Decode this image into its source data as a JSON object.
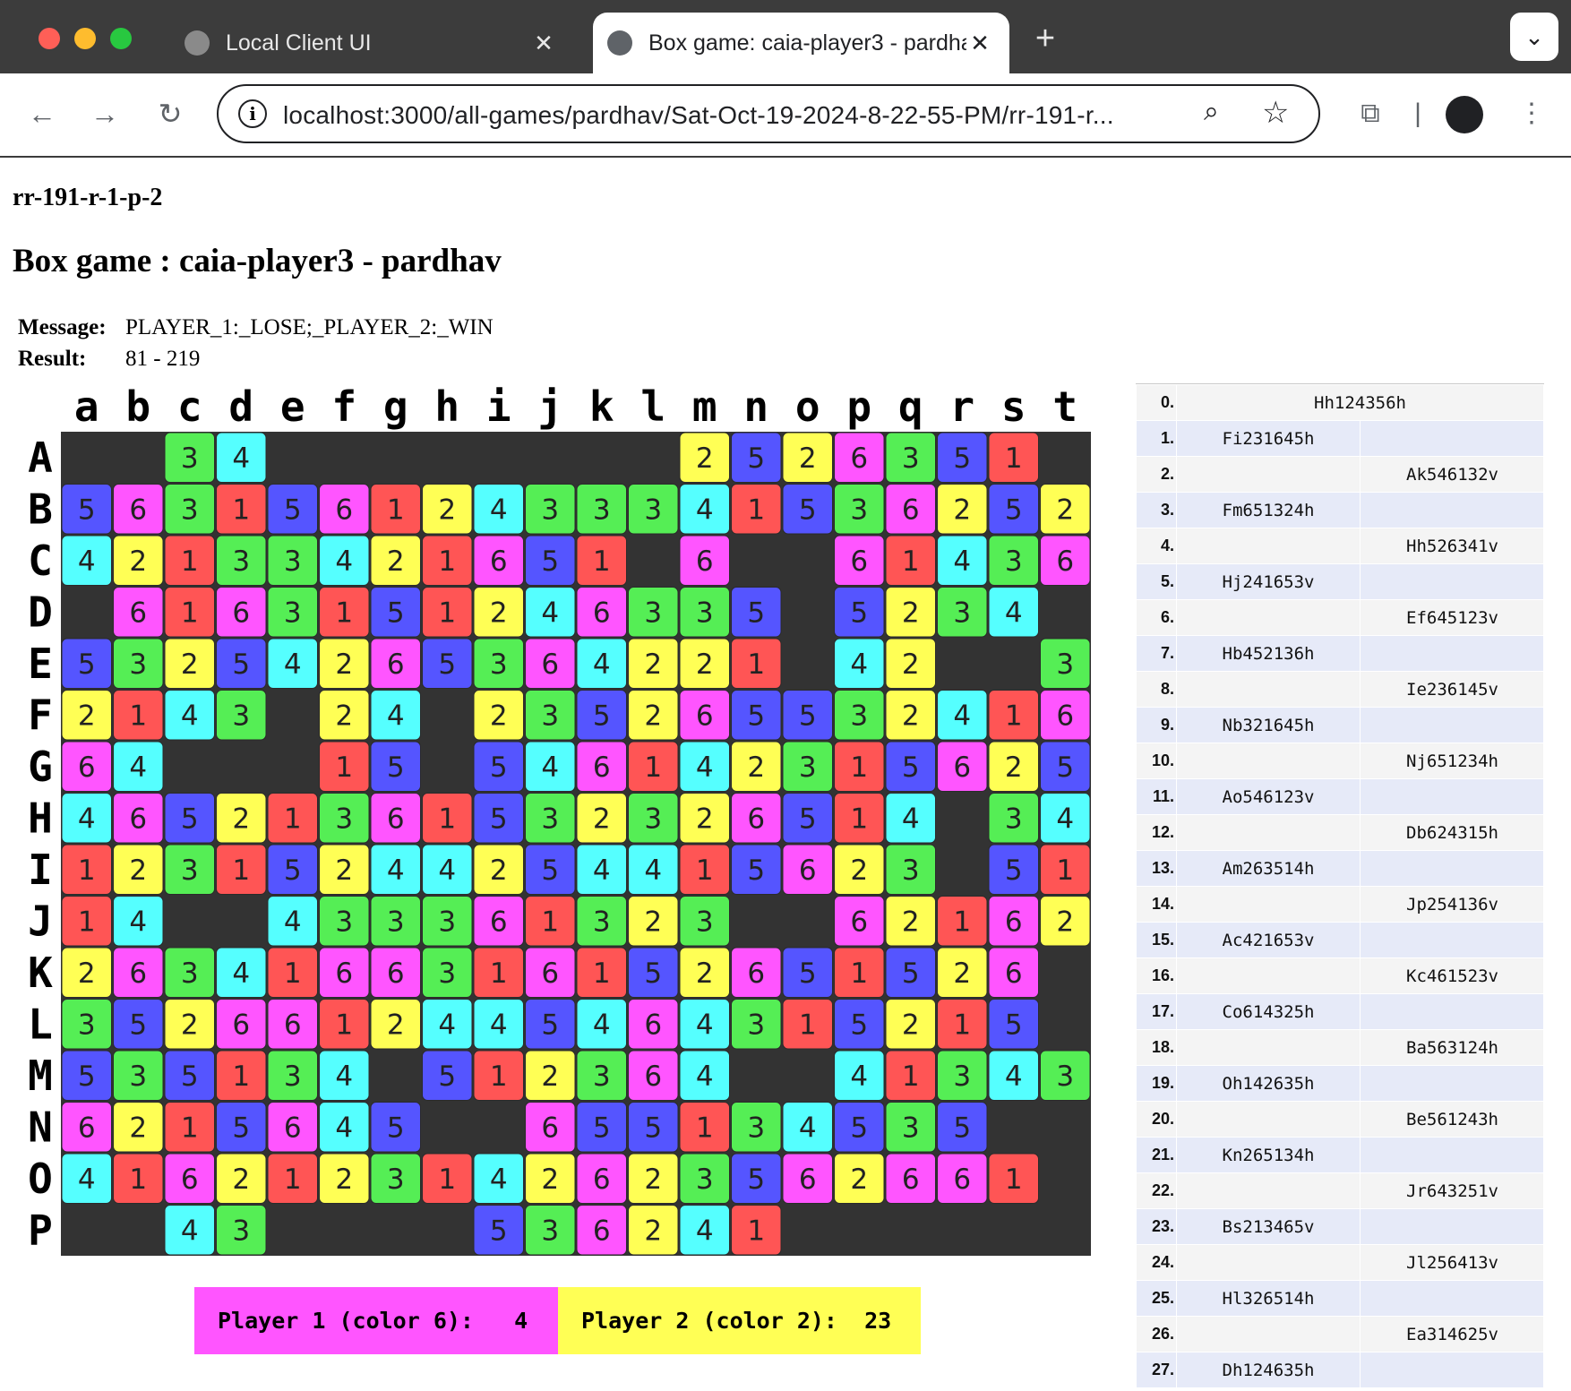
{
  "browser": {
    "tabs": [
      {
        "title": "Local Client UI"
      },
      {
        "title": "Box game: caia-player3 - pardhav"
      }
    ],
    "url": "localhost:3000/all-games/pardhav/Sat-Oct-19-2024-8-22-55-PM/rr-191-r..."
  },
  "page": {
    "game_id": "rr-191-r-1-p-2",
    "heading": "Box game : caia-player3 - pardhav",
    "message_label": "Message:",
    "message": "PLAYER_1:_LOSE;_PLAYER_2:_WIN",
    "result_label": "Result:",
    "result": "81 - 219"
  },
  "board": {
    "columns": [
      "a",
      "b",
      "c",
      "d",
      "e",
      "f",
      "g",
      "h",
      "i",
      "j",
      "k",
      "l",
      "m",
      "n",
      "o",
      "p",
      "q",
      "r",
      "s",
      "t"
    ],
    "rows": [
      "A",
      "B",
      "C",
      "D",
      "E",
      "F",
      "G",
      "H",
      "I",
      "J",
      "K",
      "L",
      "M",
      "N",
      "O",
      "P"
    ],
    "colors": {
      "1": "#ff5555",
      "2": "#ffff55",
      "3": "#55ee55",
      "4": "#55ffff",
      "5": "#5555ff",
      "6": "#ff55ff"
    },
    "grid": [
      "..34........2526351..",
      "56315612433341536252",
      "42133421651.6..61436.",
      ".6163151246335.5234.43",
      "53254265364221.42..34",
      "2143.24.235265532416",
      "64...15.54614231562 5",
      "46521361532326514.34",
      "12315244254415623.51",
      "14..433361323..621 62",
      "26341663161526515 26",
      "35266124454643152 15",
      "53513 4.51236 4..41343",
      "621564 5..655134535.",
      "416212314262356 2661.",
      "..43....536241......"
    ],
    "legend": {
      "p1_label": "Player 1 (color 6):",
      "p1_score": "4",
      "p2_label": "Player 2 (color 2):",
      "p2_score": "23"
    }
  },
  "moves": [
    {
      "n": "0.",
      "full": "Hh124356h"
    },
    {
      "n": "1.",
      "p1": "Fi231645h",
      "p2": ""
    },
    {
      "n": "2.",
      "p1": "",
      "p2": "Ak546132v"
    },
    {
      "n": "3.",
      "p1": "Fm651324h",
      "p2": ""
    },
    {
      "n": "4.",
      "p1": "",
      "p2": "Hh526341v"
    },
    {
      "n": "5.",
      "p1": "Hj241653v",
      "p2": ""
    },
    {
      "n": "6.",
      "p1": "",
      "p2": "Ef645123v"
    },
    {
      "n": "7.",
      "p1": "Hb452136h",
      "p2": ""
    },
    {
      "n": "8.",
      "p1": "",
      "p2": "Ie236145v"
    },
    {
      "n": "9.",
      "p1": "Nb321645h",
      "p2": ""
    },
    {
      "n": "10.",
      "p1": "",
      "p2": "Nj651234h"
    },
    {
      "n": "11.",
      "p1": "Ao546123v",
      "p2": ""
    },
    {
      "n": "12.",
      "p1": "",
      "p2": "Db624315h"
    },
    {
      "n": "13.",
      "p1": "Am263514h",
      "p2": ""
    },
    {
      "n": "14.",
      "p1": "",
      "p2": "Jp254136v"
    },
    {
      "n": "15.",
      "p1": "Ac421653v",
      "p2": ""
    },
    {
      "n": "16.",
      "p1": "",
      "p2": "Kc461523v"
    },
    {
      "n": "17.",
      "p1": "Co614325h",
      "p2": ""
    },
    {
      "n": "18.",
      "p1": "",
      "p2": "Ba563124h"
    },
    {
      "n": "19.",
      "p1": "Oh142635h",
      "p2": ""
    },
    {
      "n": "20.",
      "p1": "",
      "p2": "Be561243h"
    },
    {
      "n": "21.",
      "p1": "Kn265134h",
      "p2": ""
    },
    {
      "n": "22.",
      "p1": "",
      "p2": "Jr643251v"
    },
    {
      "n": "23.",
      "p1": "Bs213465v",
      "p2": ""
    },
    {
      "n": "24.",
      "p1": "",
      "p2": "Jl256413v"
    },
    {
      "n": "25.",
      "p1": "Hl326514h",
      "p2": ""
    },
    {
      "n": "26.",
      "p1": "",
      "p2": "Ea314625v"
    },
    {
      "n": "27.",
      "p1": "Dh124635h",
      "p2": ""
    }
  ]
}
